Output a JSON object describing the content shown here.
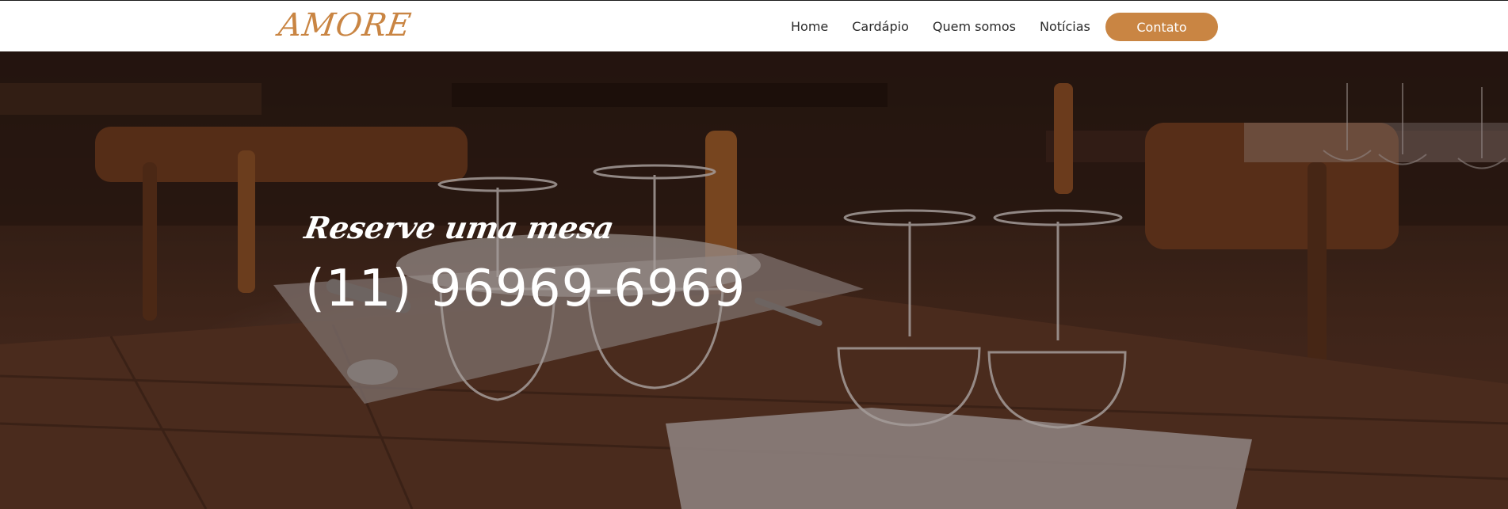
{
  "brand": {
    "logo_text": "AMORE",
    "accent_color": "#c98543"
  },
  "nav": {
    "items": [
      {
        "label": "Home"
      },
      {
        "label": "Cardápio"
      },
      {
        "label": "Quem somos"
      },
      {
        "label": "Notícias"
      }
    ],
    "contact_label": "Contato"
  },
  "hero": {
    "tagline": "Reserve uma mesa",
    "phone": "(11) 96969-6969",
    "background_image": "restaurant-table-with-wine-glasses"
  }
}
